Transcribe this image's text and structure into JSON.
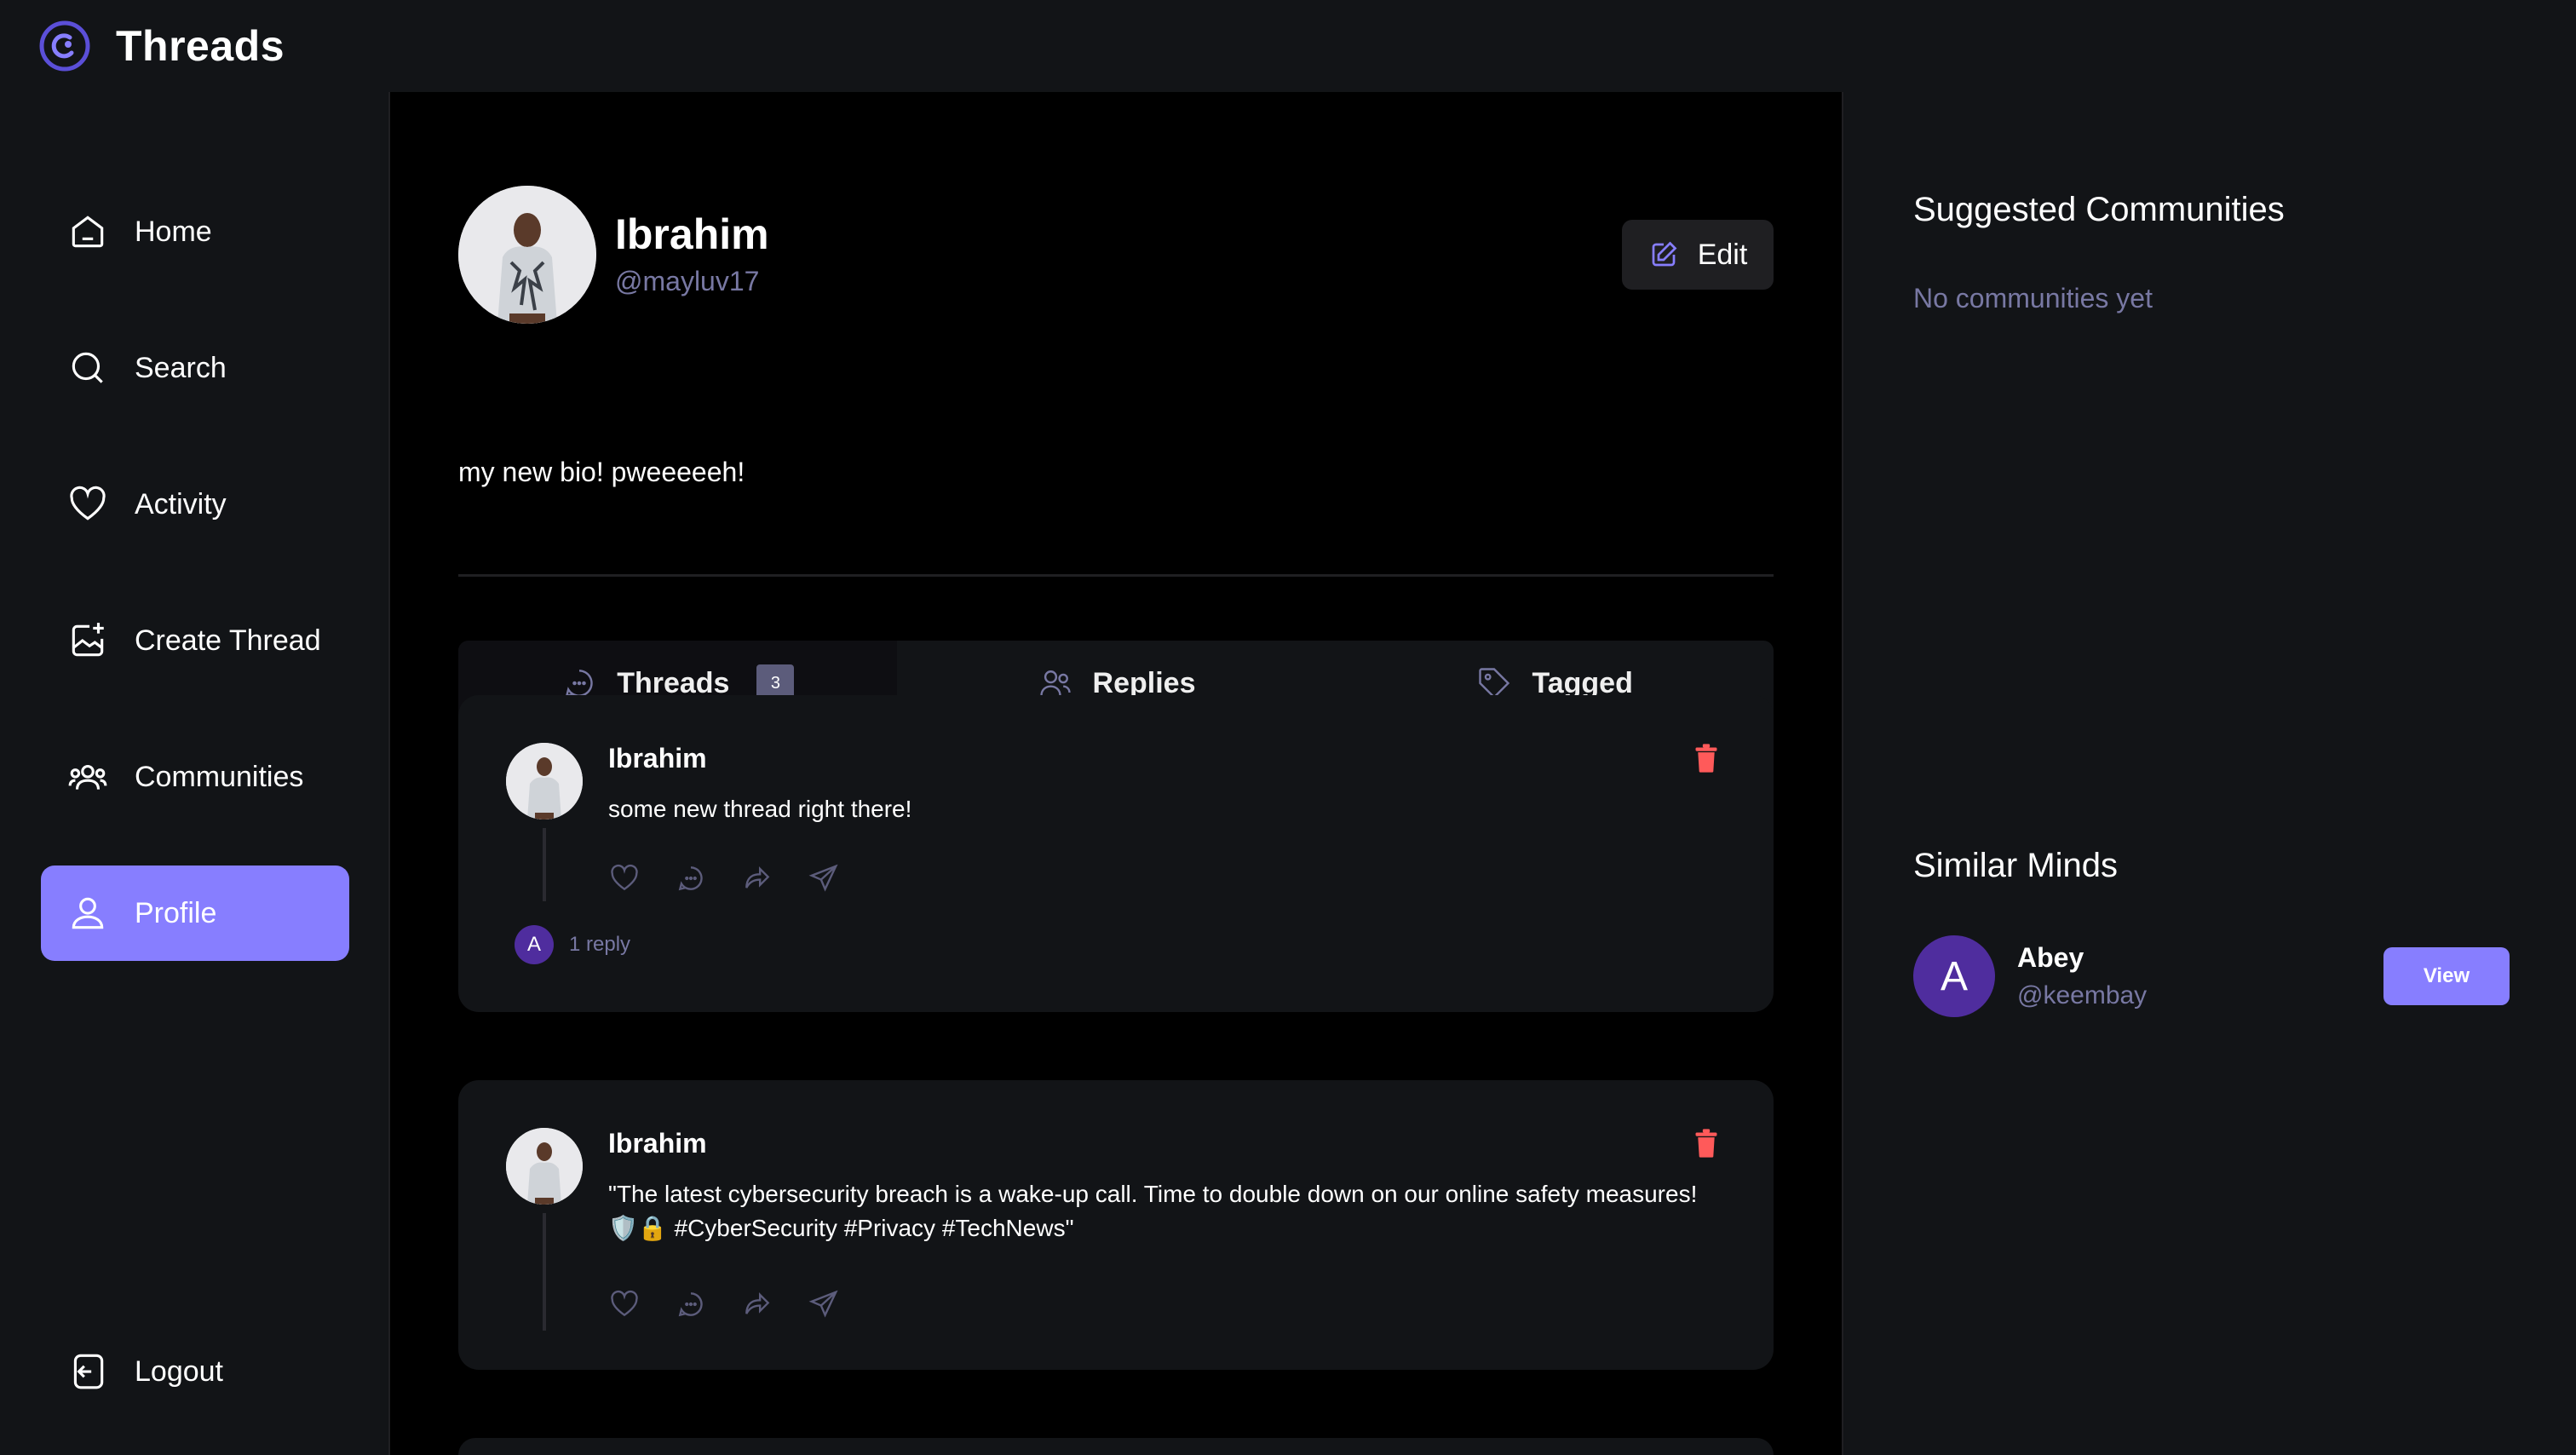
{
  "app": {
    "title": "Threads"
  },
  "colors": {
    "accent": "#877eff",
    "danger": "#ff5a5a",
    "muted": "#7878a3"
  },
  "sidebar": {
    "items": [
      {
        "label": "Home",
        "icon": "home-icon"
      },
      {
        "label": "Search",
        "icon": "search-icon"
      },
      {
        "label": "Activity",
        "icon": "heart-icon"
      },
      {
        "label": "Create Thread",
        "icon": "create-thread-icon"
      },
      {
        "label": "Communities",
        "icon": "communities-icon"
      },
      {
        "label": "Profile",
        "icon": "user-icon",
        "active": true
      }
    ],
    "logout_label": "Logout"
  },
  "profile": {
    "name": "Ibrahim",
    "handle": "@mayluv17",
    "bio": "my new bio! pweeeeeh!",
    "edit_label": "Edit"
  },
  "tabs": [
    {
      "label": "Threads",
      "count": "3",
      "active": true
    },
    {
      "label": "Replies"
    },
    {
      "label": "Tagged"
    }
  ],
  "threads": [
    {
      "author": "Ibrahim",
      "content": "some new thread right there!",
      "replies": {
        "initial": "A",
        "label": "1 reply"
      }
    },
    {
      "author": "Ibrahim",
      "content": "\"The latest cybersecurity breach is a wake-up call. Time to double down on our online safety measures! 🛡️🔒 #CyberSecurity #Privacy #TechNews\""
    }
  ],
  "right": {
    "communities_title": "Suggested Communities",
    "communities_empty": "No communities yet",
    "similar_title": "Similar Minds",
    "user": {
      "initial": "A",
      "name": "Abey",
      "handle": "@keembay",
      "button": "View"
    }
  }
}
